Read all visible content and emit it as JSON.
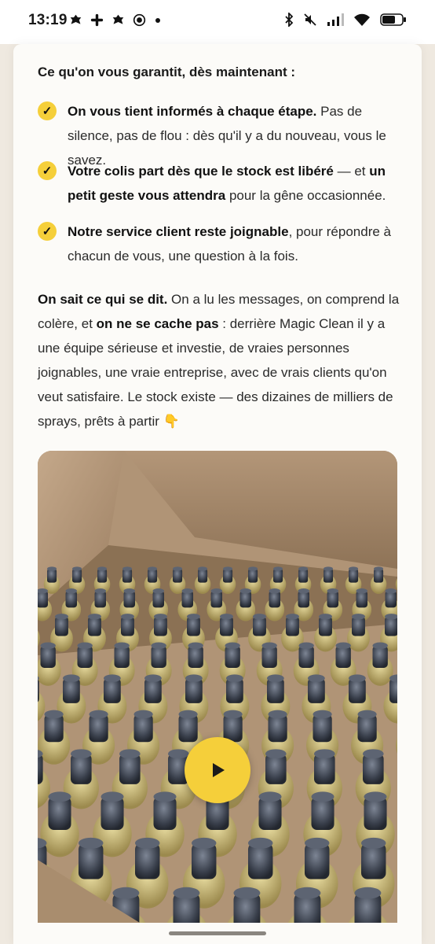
{
  "status_bar": {
    "time": "13:19",
    "left_icons": [
      "notification-icon",
      "slack-icon",
      "notification-icon",
      "record-icon",
      "dot-icon"
    ],
    "right_icons": [
      "bluetooth-icon",
      "mute-icon",
      "signal-icon",
      "wifi-icon",
      "battery-icon"
    ]
  },
  "content": {
    "heading": "Ce qu'on vous garantit, dès maintenant :",
    "bullets": [
      {
        "check": "✓",
        "bold1": "On vous tient informés à chaque étape.",
        "text1": " Pas de silence, pas de flou : dès qu'il y a du nouveau, vous le savez."
      },
      {
        "check": "✓",
        "bold1": "Votre colis part dès que le stock est libéré",
        "text1": " — et ",
        "bold2": "un petit geste vous attendra",
        "text2": " pour la gêne occasionnée."
      },
      {
        "check": "✓",
        "bold1": "Notre service client reste joignable",
        "text1": ", pour répondre à chacun de vous, une question à la fois."
      }
    ],
    "paragraph": {
      "bold1": "On sait ce qui se dit.",
      "text1": " On a lu les messages, on comprend la colère, et ",
      "bold2": "on ne se cache pas",
      "text2": " : derrière Magic Clean il y a une équipe sérieuse et investie, de vraies personnes joignables, une vraie entreprise, avec de vrais clients qu'on veut satisfaire. Le stock existe — des dizaines de milliers de sprays, prêts à partir 👇"
    }
  },
  "video": {
    "icon": "play-icon",
    "thumbnail": "box of spray bottles"
  },
  "colors": {
    "accent": "#f5cf3a",
    "page_bg": "#efe9e0",
    "card_bg": "#fcfbf8",
    "text": "#1a1a1a"
  }
}
